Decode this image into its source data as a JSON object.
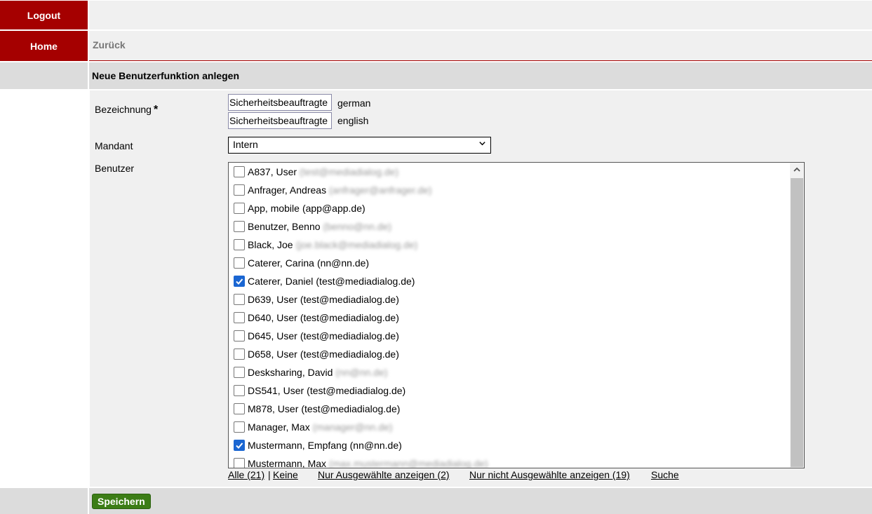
{
  "nav": {
    "logout_label": "Logout",
    "home_label": "Home",
    "back_label": "Zurück"
  },
  "header": {
    "title": "Neue Benutzerfunktion anlegen"
  },
  "form": {
    "designation_label": "Bezeichnung",
    "required_mark": "*",
    "designation_german": "Sicherheitsbeauftragte",
    "german_label": "german",
    "designation_english": "Sicherheitsbeauftragte",
    "english_label": "english",
    "client_label": "Mandant",
    "client_value": "Intern",
    "users_label": "Benutzer"
  },
  "users": [
    {
      "name": "A837, User",
      "email": "(test@mediadialog.de)",
      "checked": false,
      "blurred": true
    },
    {
      "name": "Anfrager, Andreas",
      "email": "(anfrager@anfrager.de)",
      "checked": false,
      "blurred": true
    },
    {
      "name": "App, mobile",
      "email": "(app@app.de)",
      "checked": false,
      "blurred": false
    },
    {
      "name": "Benutzer, Benno",
      "email": "(benno@nn.de)",
      "checked": false,
      "blurred": true
    },
    {
      "name": "Black, Joe",
      "email": "(joe.black@mediadialog.de)",
      "checked": false,
      "blurred": true
    },
    {
      "name": "Caterer, Carina",
      "email": "(nn@nn.de)",
      "checked": false,
      "blurred": false
    },
    {
      "name": "Caterer, Daniel",
      "email": "(test@mediadialog.de)",
      "checked": true,
      "blurred": false
    },
    {
      "name": "D639, User",
      "email": "(test@mediadialog.de)",
      "checked": false,
      "blurred": false
    },
    {
      "name": "D640, User",
      "email": "(test@mediadialog.de)",
      "checked": false,
      "blurred": false
    },
    {
      "name": "D645, User",
      "email": "(test@mediadialog.de)",
      "checked": false,
      "blurred": false
    },
    {
      "name": "D658, User",
      "email": "(test@mediadialog.de)",
      "checked": false,
      "blurred": false
    },
    {
      "name": "Desksharing, David",
      "email": "(nn@nn.de)",
      "checked": false,
      "blurred": true
    },
    {
      "name": "DS541, User",
      "email": "(test@mediadialog.de)",
      "checked": false,
      "blurred": false
    },
    {
      "name": "M878, User",
      "email": "(test@mediadialog.de)",
      "checked": false,
      "blurred": false
    },
    {
      "name": "Manager, Max",
      "email": "(manager@nn.de)",
      "checked": false,
      "blurred": true
    },
    {
      "name": "Mustermann, Empfang",
      "email": "(nn@nn.de)",
      "checked": true,
      "blurred": false
    },
    {
      "name": "Mustermann, Max",
      "email": "(max.mustermann@mediadialog.de)",
      "checked": false,
      "blurred": true
    }
  ],
  "links": {
    "all": "Alle (21)",
    "separator": "|",
    "none": "Keine",
    "only_selected": "Nur Ausgewählte anzeigen (2)",
    "only_unselected": "Nur nicht Ausgewählte anzeigen (19)",
    "search": "Suche"
  },
  "footer": {
    "save_label": "Speichern"
  },
  "colors": {
    "nav_red": "#a50000",
    "save_green": "#3c7d16",
    "check_blue": "#1a66d2"
  }
}
